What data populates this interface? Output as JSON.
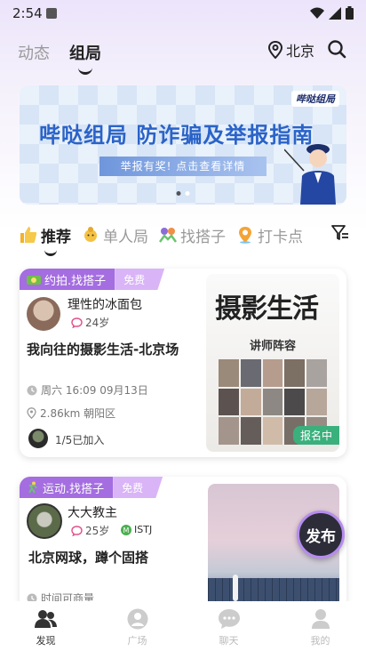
{
  "status_bar": {
    "time": "2:54"
  },
  "header": {
    "tabs": [
      {
        "label": "动态",
        "active": false
      },
      {
        "label": "组局",
        "active": true
      }
    ],
    "location": "北京",
    "location_icon": "location-pin-icon",
    "search_icon": "search-icon"
  },
  "banner": {
    "logo": "哔哒组局",
    "title": "哔哒组局  防诈骗及举报指南",
    "button_text": "举报有奖! 点击查看详情",
    "page_indicator": {
      "count": 2,
      "active": 0
    }
  },
  "filter_tabs": [
    {
      "label": "推荐",
      "icon": "thumbs-up-icon",
      "active": true
    },
    {
      "label": "单人局",
      "icon": "single-person-icon",
      "active": false
    },
    {
      "label": "找搭子",
      "icon": "partner-icon",
      "active": false
    },
    {
      "label": "打卡点",
      "icon": "location-marker-icon",
      "active": false
    }
  ],
  "cards": [
    {
      "tag": "约拍.找搭子",
      "free": "免费",
      "user": {
        "name": "理性的冰面包",
        "age": "24岁"
      },
      "title": "我向往的摄影生活-北京场",
      "time": "周六 16:09 09月13日",
      "distance": "2.86km 朝阳区",
      "join": "1/5已加入",
      "poster": {
        "headline": "摄影生活",
        "subtitle": "讲师阵容",
        "badge": "报名中"
      }
    },
    {
      "tag": "运动.找搭子",
      "free": "免费",
      "user": {
        "name": "大大教主",
        "age": "25岁",
        "mbti": "ISTJ"
      },
      "title": "北京网球，蹲个固搭",
      "time": "时间可商量"
    }
  ],
  "publish_button": "发布",
  "bottom_nav": [
    {
      "label": "发现",
      "icon": "discover-icon",
      "active": true
    },
    {
      "label": "广场",
      "icon": "plaza-icon",
      "active": false
    },
    {
      "label": "聊天",
      "icon": "chat-icon",
      "active": false
    },
    {
      "label": "我的",
      "icon": "profile-icon",
      "active": false
    }
  ],
  "colors": {
    "accent_purple": "#a46de0",
    "tag_light": "#d9b4f7",
    "banner_blue": "#2a63c8"
  }
}
